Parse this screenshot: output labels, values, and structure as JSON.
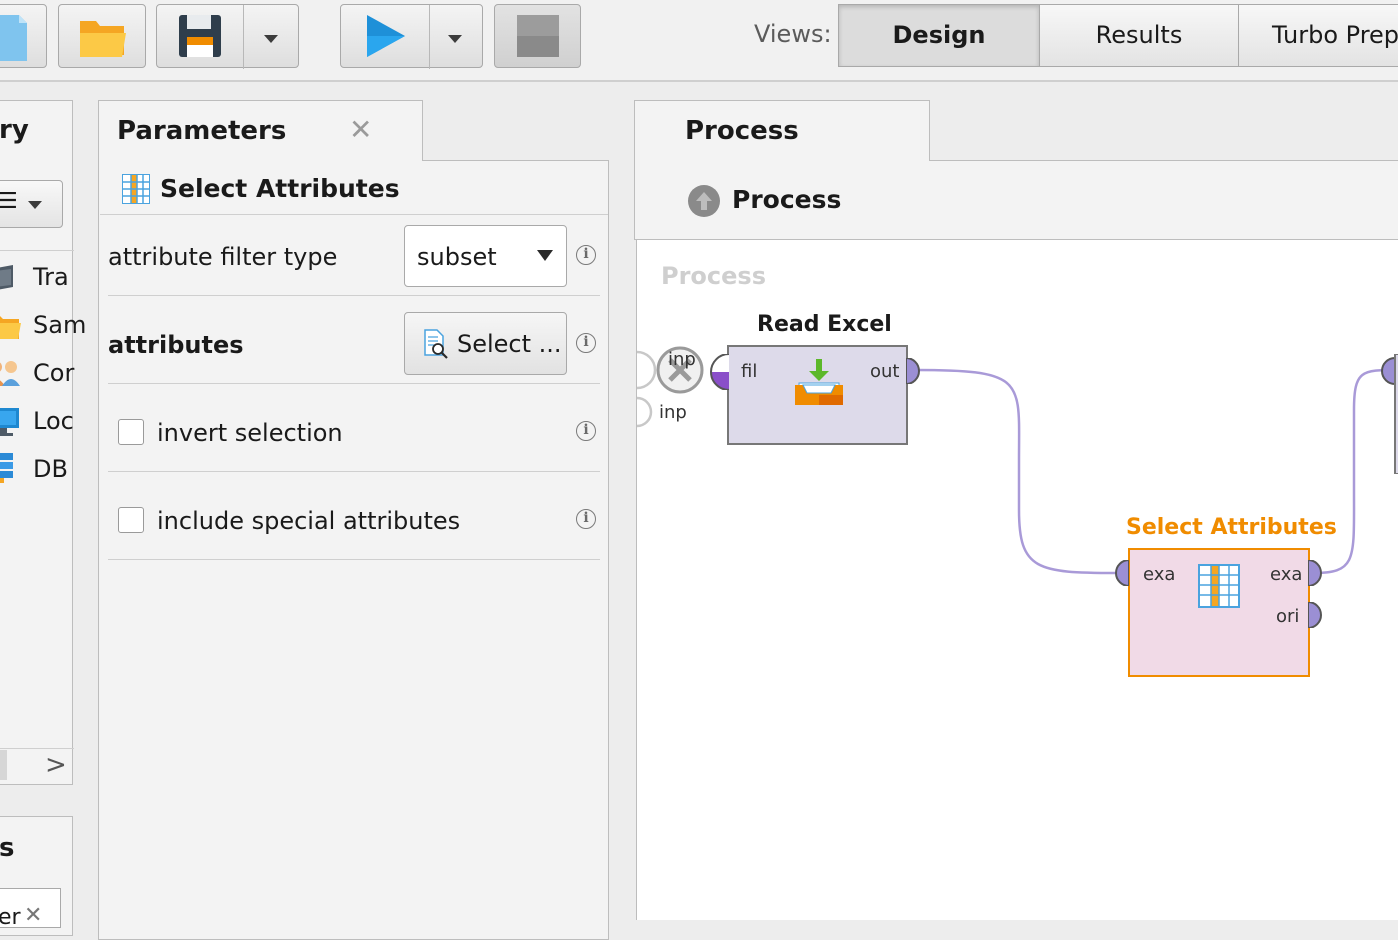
{
  "toolbar": {
    "views_label": "Views:",
    "views": [
      {
        "label": "Design",
        "active": true
      },
      {
        "label": "Results",
        "active": false
      },
      {
        "label": "Turbo Prep",
        "active": false
      }
    ]
  },
  "left_panel": {
    "tab_title_partial": "ry",
    "items": [
      {
        "label": "Tra",
        "icon": "training-icon"
      },
      {
        "label": "Sam",
        "icon": "folder-icon"
      },
      {
        "label": "Cor",
        "icon": "community-icon"
      },
      {
        "label": "Loc",
        "icon": "monitor-icon"
      },
      {
        "label": "DB",
        "icon": "database-icon"
      }
    ],
    "bottom_tab_partial": "s",
    "bottom_input_partial": "er"
  },
  "parameters": {
    "tab_title": "Parameters",
    "operator_title": "Select Attributes",
    "rows": {
      "filter_type_label": "attribute filter type",
      "filter_type_value": "subset",
      "attributes_label": "attributes",
      "attributes_button": "Select ...",
      "invert_label": "invert selection",
      "invert_checked": false,
      "special_label": "include special attributes",
      "special_checked": false
    }
  },
  "process": {
    "tab_title": "Process",
    "breadcrumb": "Process",
    "canvas_watermark": "Process",
    "input_ports": [
      "inp",
      "inp"
    ],
    "operators": {
      "read_excel": {
        "name": "Read Excel",
        "in_port": "fil",
        "out_port": "out"
      },
      "select_attributes": {
        "name": "Select Attributes",
        "in_port": "exa",
        "out_ports": [
          "exa",
          "ori"
        ]
      }
    }
  },
  "colors": {
    "accent_orange": "#f08c00",
    "port_purple": "#9b8fd4",
    "connection": "#a99ad8",
    "read_excel_fill": "#dddaea",
    "select_attr_fill": "#f1dae7"
  }
}
